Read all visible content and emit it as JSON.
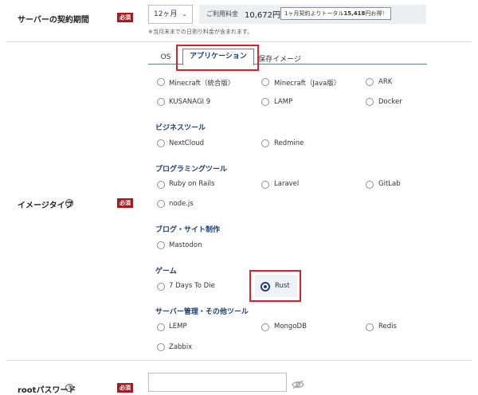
{
  "contract": {
    "label": "サーバーの契約期間",
    "required": "必須",
    "period": "12ヶ月",
    "fee_label": "ご利用料金",
    "fee_value": "10,672円",
    "promo_prefix": "1ヶ月契約よりトータル",
    "promo_amount": "15,418",
    "promo_suffix": "円お得！",
    "note": "※当月末までの日割り料金が含まれます。"
  },
  "image_type": {
    "label": "イメージタイプ",
    "help": "?",
    "required": "必須",
    "tabs": [
      "OS",
      "アプリケーション",
      "保存イメージ"
    ],
    "top_options": [
      "Minecraft（統合版）",
      "Minecraft（Java版）",
      "ARK",
      "KUSANAGI 9",
      "LAMP",
      "Docker"
    ],
    "categories": [
      {
        "title": "ビジネスツール",
        "options": [
          "NextCloud",
          "Redmine"
        ]
      },
      {
        "title": "プログラミングツール",
        "options": [
          "Ruby on Rails",
          "Laravel",
          "GitLab",
          "node.js"
        ]
      },
      {
        "title": "ブログ・サイト制作",
        "options": [
          "Mastodon"
        ]
      },
      {
        "title": "ゲーム",
        "options": [
          "7 Days To Die",
          "Rust"
        ]
      },
      {
        "title": "サーバー管理・その他ツール",
        "options": [
          "LEMP",
          "MongoDB",
          "Redis",
          "Zabbix"
        ]
      }
    ],
    "selected": "Rust"
  },
  "root_password": {
    "label": "rootパスワード",
    "help": "?",
    "required": "必須",
    "value": ""
  },
  "colors": {
    "required_badge": "#a8191f",
    "highlight": "#d8232a",
    "accent": "#1e3d73"
  }
}
